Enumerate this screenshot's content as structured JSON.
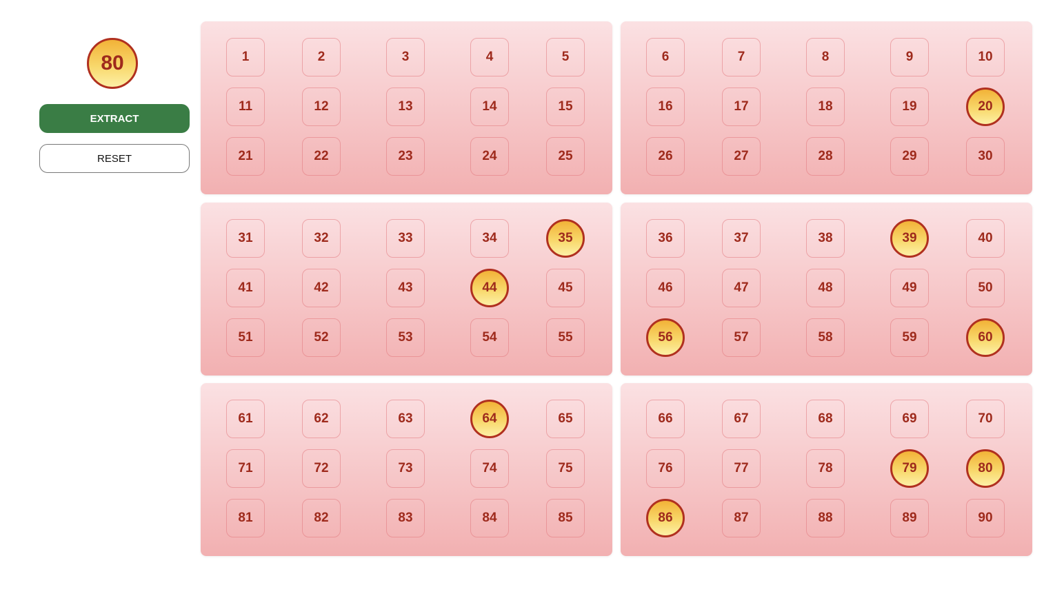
{
  "current_number": "80",
  "buttons": {
    "extract_label": "EXTRACT",
    "reset_label": "RESET"
  },
  "colors": {
    "panel_top": "#fbe1e3",
    "panel_bottom": "#f2b0b1",
    "number_text": "#9e2a1c",
    "drawn_ball_border": "#b0301f",
    "drawn_ball_fill": "#f8d76a",
    "extract_button": "#3a7d45"
  },
  "board": {
    "numbers": [
      1,
      2,
      3,
      4,
      5,
      6,
      7,
      8,
      9,
      10,
      11,
      12,
      13,
      14,
      15,
      16,
      17,
      18,
      19,
      20,
      21,
      22,
      23,
      24,
      25,
      26,
      27,
      28,
      29,
      30,
      31,
      32,
      33,
      34,
      35,
      36,
      37,
      38,
      39,
      40,
      41,
      42,
      43,
      44,
      45,
      46,
      47,
      48,
      49,
      50,
      51,
      52,
      53,
      54,
      55,
      56,
      57,
      58,
      59,
      60,
      61,
      62,
      63,
      64,
      65,
      66,
      67,
      68,
      69,
      70,
      71,
      72,
      73,
      74,
      75,
      76,
      77,
      78,
      79,
      80,
      81,
      82,
      83,
      84,
      85,
      86,
      87,
      88,
      89,
      90
    ],
    "drawn": [
      20,
      35,
      39,
      44,
      56,
      60,
      64,
      79,
      80,
      86
    ]
  }
}
